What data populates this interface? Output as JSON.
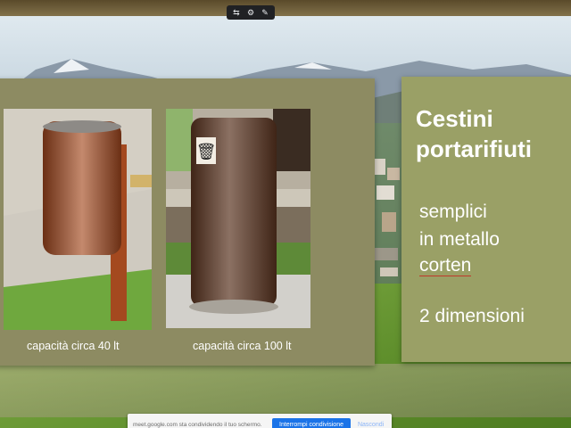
{
  "meet_controls": {
    "icons": [
      "people-icon",
      "gear-icon",
      "pin-icon"
    ],
    "glyphs": [
      "⇆",
      "⚙",
      "✎"
    ]
  },
  "slide": {
    "title_line1": "Cestini",
    "title_line2": "portarifiuti",
    "body_line1": "semplici",
    "body_line2": "in metallo",
    "body_line3": "corten",
    "body_line4": "2 dimensioni",
    "caption_small": "capacità circa 40 lt",
    "caption_large": "capacità circa 100 lt",
    "colors": {
      "photo_panel": "#8d8b62",
      "title_panel": "#9aa066",
      "corten_bin": "#a4491f",
      "brown_bin": "#5a3420"
    }
  },
  "share_bar": {
    "message": "meet.google.com sta condividendo il tuo schermo.",
    "stop_label": "Interrompi condivisione",
    "hide_label": "Nascondi",
    "accent_color": "#1a73e8"
  }
}
